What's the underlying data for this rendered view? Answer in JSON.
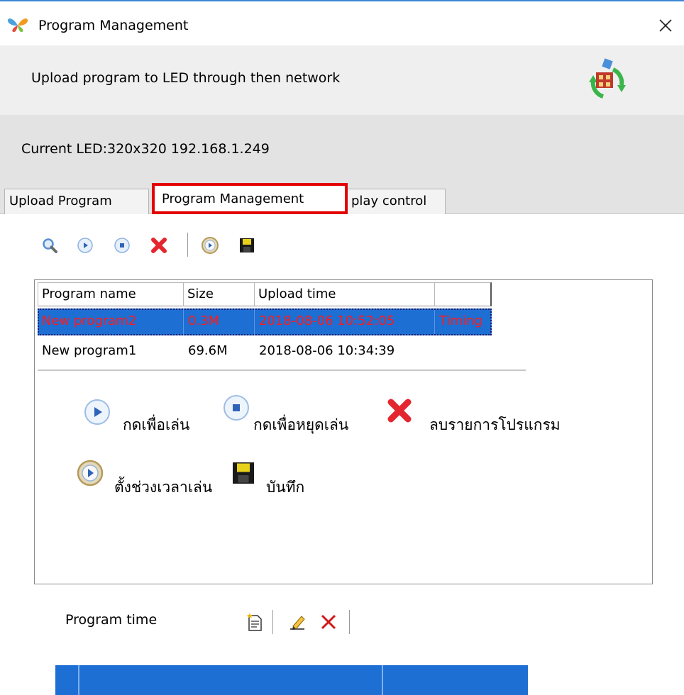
{
  "window": {
    "title": "Program Management",
    "close_glyph": "✕"
  },
  "header": {
    "text": "Upload program to LED  through then network",
    "icon": "network-upload-icon"
  },
  "current_led": {
    "text": "Current LED:320x320 192.168.1.249"
  },
  "tabs": [
    {
      "label": "Upload Program",
      "active": false
    },
    {
      "label": "Program Management",
      "active": true
    },
    {
      "label": "play control",
      "active": false
    }
  ],
  "toolbar": {
    "icons": [
      "search-icon",
      "play-icon",
      "stop-icon",
      "delete-icon",
      "timer-icon",
      "save-icon"
    ]
  },
  "program_list": {
    "columns": [
      "Program name",
      "Size",
      "Upload time",
      ""
    ],
    "rows": [
      {
        "name": "New program2",
        "size": "0.3M",
        "upload_time": "2018-08-06 10:52:05",
        "extra": "Timing",
        "selected": true
      },
      {
        "name": "New program1",
        "size": "69.6M",
        "upload_time": "2018-08-06 10:34:39",
        "extra": "",
        "selected": false
      }
    ]
  },
  "legend": {
    "play": "กดเพื่อเล่น",
    "stop": "กดเพื่อหยุดเล่น",
    "delete": "ลบรายการโปรแกรม",
    "timer": "ตั้งช่วงเวลาเล่น",
    "save": "บันทึก"
  },
  "program_time": {
    "label": "Program time",
    "icons": [
      "add-document-icon",
      "edit-icon",
      "delete-x-icon"
    ]
  },
  "colors": {
    "selection_blue": "#1e6fd3",
    "selection_text": "#ff1a1a",
    "highlight_red": "#e30000",
    "window_accent": "#3c88d6"
  }
}
